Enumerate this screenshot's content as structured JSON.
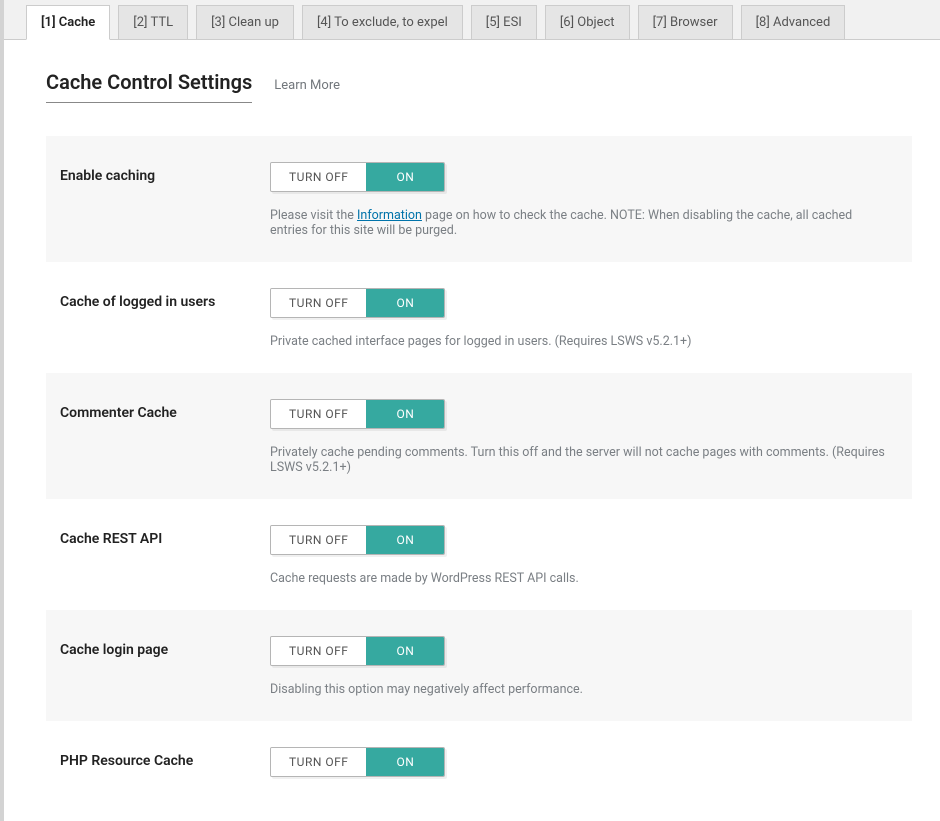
{
  "tabs": {
    "t0": "[1] Cache",
    "t1": "[2] TTL",
    "t2": "[3] Clean up",
    "t3": "[4] To exclude, to expel",
    "t4": "[5] ESI",
    "t5": "[6] Object",
    "t6": "[7] Browser",
    "t7": "[8] Advanced"
  },
  "heading": "Cache Control Settings",
  "learn_more": "Learn More",
  "toggle": {
    "off": "TURN OFF",
    "on": "ON"
  },
  "rows": {
    "enable": {
      "label": "Enable caching",
      "desc_pre": "Please visit the ",
      "desc_link": "Information",
      "desc_post": " page on how to check the cache. NOTE: When disabling the cache, all cached entries for this site will be purged."
    },
    "logged": {
      "label": "Cache of logged in users",
      "desc": "Private cached interface pages for logged in users. (Requires LSWS v5.2.1+)"
    },
    "commenter": {
      "label": "Commenter Cache",
      "desc": "Privately cache pending comments. Turn this off and the server will not cache pages with comments. (Requires LSWS v5.2.1+)"
    },
    "rest": {
      "label": "Cache REST API",
      "desc": "Cache requests are made by WordPress REST API calls."
    },
    "login": {
      "label": "Cache login page",
      "desc": "Disabling this option may negatively affect performance."
    },
    "php": {
      "label": "PHP Resource Cache"
    }
  }
}
